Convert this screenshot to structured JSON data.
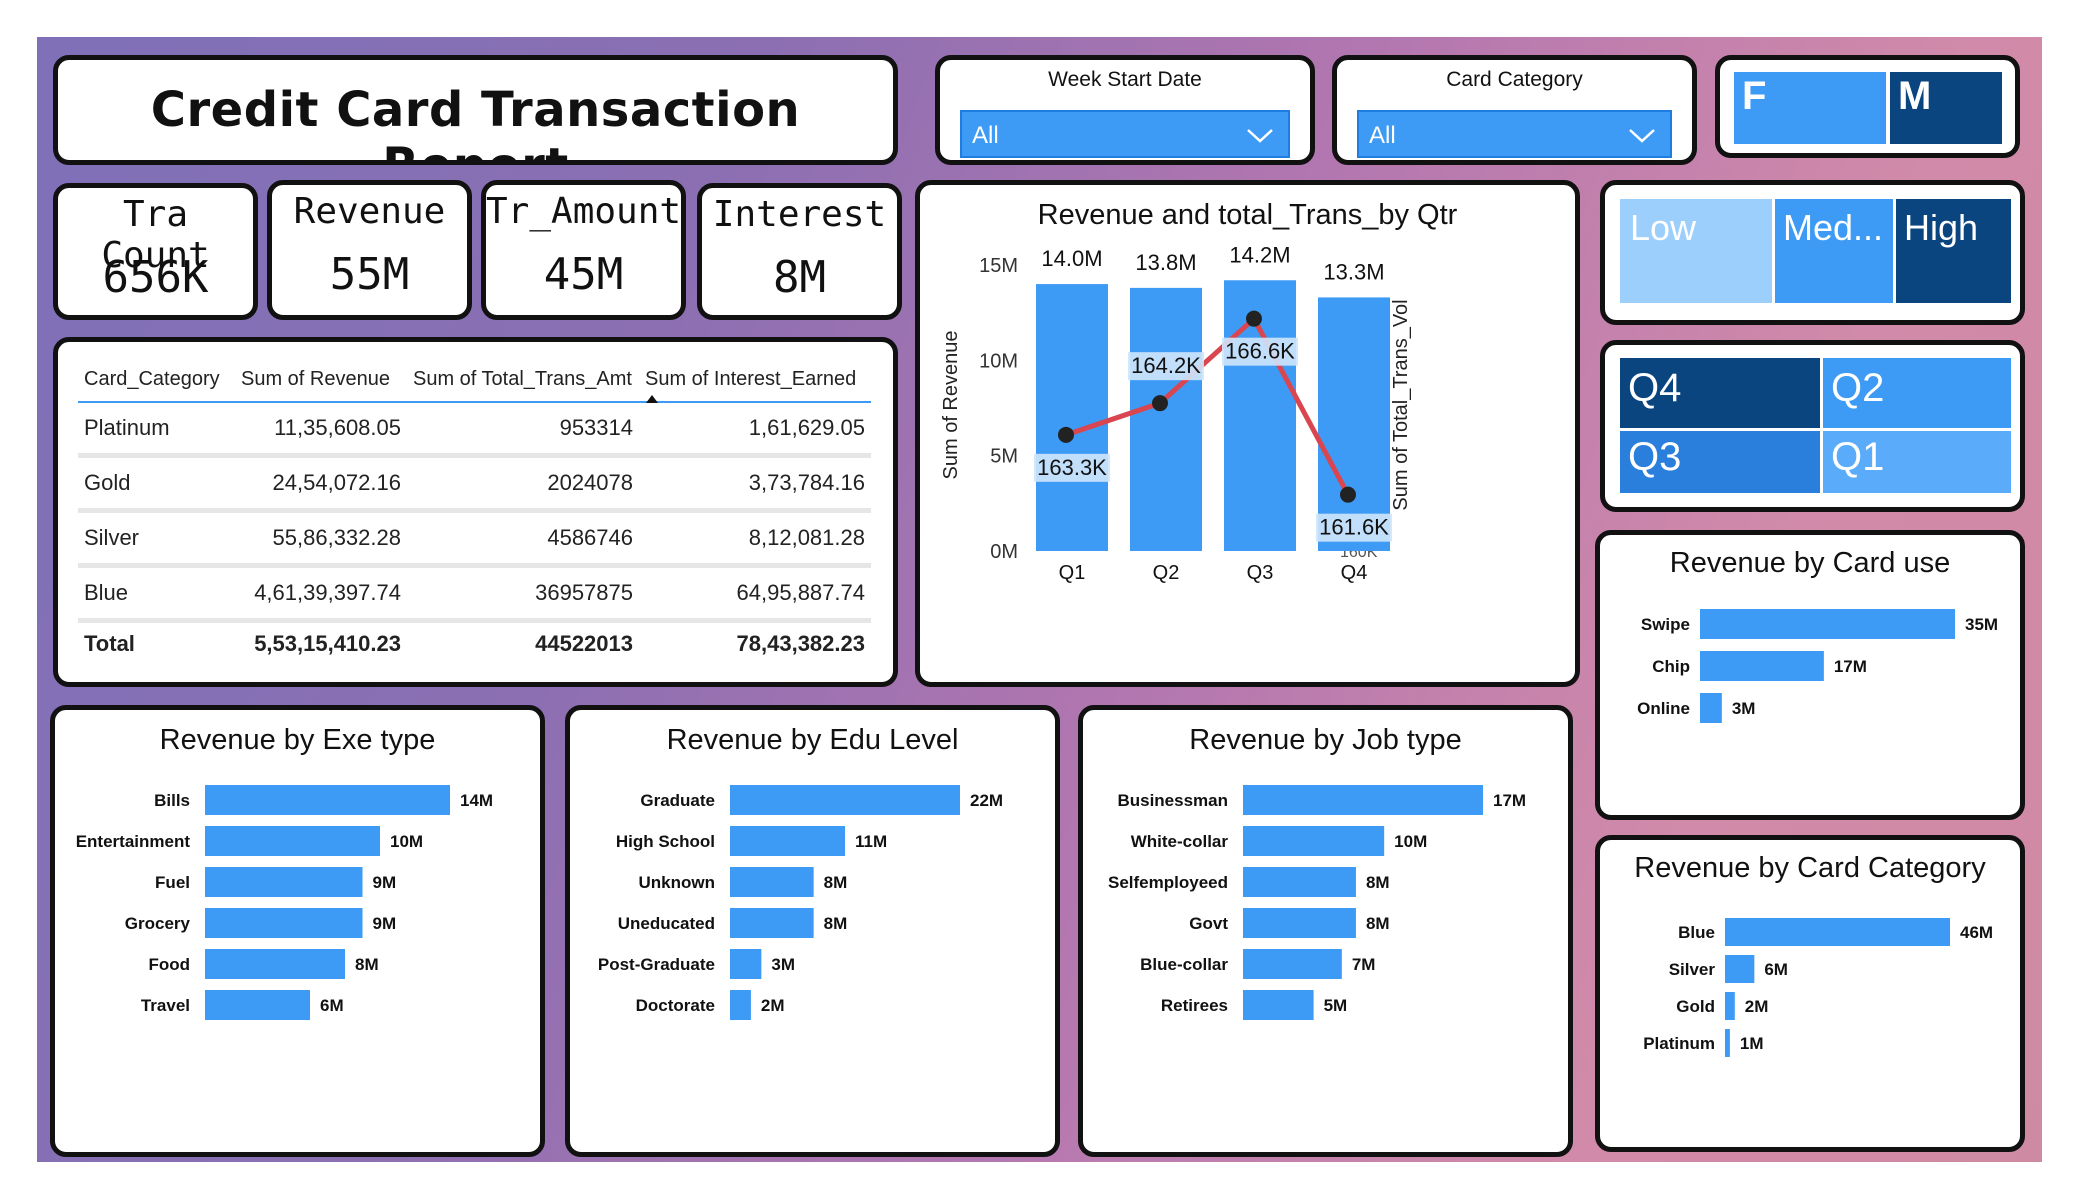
{
  "report_title": "Credit Card Transaction Report",
  "slicers": [
    {
      "label": "Week Start Date",
      "value": "All"
    },
    {
      "label": "Card Category",
      "value": "All"
    }
  ],
  "gender": {
    "f": "F",
    "m": "M"
  },
  "income_levels": [
    "Low",
    "Med...",
    "High"
  ],
  "quarter_tiles": [
    "Q4",
    "Q2",
    "Q3",
    "Q1"
  ],
  "kpis": [
    {
      "label": "Tra Count",
      "value": "656K"
    },
    {
      "label": "Revenue",
      "value": "55M"
    },
    {
      "label": "Tr_Amount",
      "value": "45M"
    },
    {
      "label": "Interest",
      "value": "8M"
    }
  ],
  "matrix": {
    "headers": [
      "Card_Category",
      "Sum of Revenue",
      "Sum of Total_Trans_Amt",
      "Sum of Interest_Earned"
    ],
    "rows": [
      [
        "Platinum",
        "11,35,608.05",
        "953314",
        "1,61,629.05"
      ],
      [
        "Gold",
        "24,54,072.16",
        "2024078",
        "3,73,784.16"
      ],
      [
        "Silver",
        "55,86,332.28",
        "4586746",
        "8,12,081.28"
      ],
      [
        "Blue",
        "4,61,39,397.74",
        "36957875",
        "64,95,887.74"
      ]
    ],
    "total": [
      "Total",
      "5,53,15,410.23",
      "44522013",
      "78,43,382.23"
    ]
  },
  "colors": {
    "bar": "#3d9af5",
    "dark": "#0b4580",
    "mid": "#2a7fdc",
    "light": "#9ccffb",
    "line": "#d9464f"
  },
  "chart_data": [
    {
      "type": "bar",
      "title": "Revenue and total_Trans_by Qtr",
      "categories": [
        "Q1",
        "Q2",
        "Q3",
        "Q4"
      ],
      "series": [
        {
          "values": [
            14.0,
            13.8,
            14.2,
            13.3
          ],
          "labels": [
            "14.0M",
            "13.8M",
            "14.2M",
            "13.3M"
          ]
        },
        {
          "values": [
            163.3,
            164.2,
            166.6,
            161.6
          ],
          "labels": [
            "163.3K",
            "164.2K",
            "166.6K",
            "161.6K"
          ]
        }
      ],
      "ylabel": "Sum of Revenue",
      "y2label": "Sum of Total_Trans_Vol",
      "ylim": [
        0,
        15
      ],
      "yticks": [
        "0M",
        "5M",
        "10M",
        "15M"
      ],
      "y2lim": [
        160,
        165
      ],
      "y2ticks": [
        "160K",
        "165K"
      ]
    },
    {
      "type": "bar",
      "title": "Revenue by Exe type",
      "categories": [
        "Bills",
        "Entertainment",
        "Fuel",
        "Grocery",
        "Food",
        "Travel"
      ],
      "values": [
        14,
        10,
        9,
        9,
        8,
        6
      ],
      "labels": [
        "14M",
        "10M",
        "9M",
        "9M",
        "8M",
        "6M"
      ]
    },
    {
      "type": "bar",
      "title": "Revenue by Edu Level",
      "categories": [
        "Graduate",
        "High School",
        "Unknown",
        "Uneducated",
        "Post-Graduate",
        "Doctorate"
      ],
      "values": [
        22,
        11,
        8,
        8,
        3,
        2
      ],
      "labels": [
        "22M",
        "11M",
        "8M",
        "8M",
        "3M",
        "2M"
      ]
    },
    {
      "type": "bar",
      "title": "Revenue by Job type",
      "categories": [
        "Businessman",
        "White-collar",
        "Selfemployeed",
        "Govt",
        "Blue-collar",
        "Retirees"
      ],
      "values": [
        17,
        10,
        8,
        8,
        7,
        5
      ],
      "labels": [
        "17M",
        "10M",
        "8M",
        "8M",
        "7M",
        "5M"
      ]
    },
    {
      "type": "bar",
      "title": "Revenue by Card use",
      "categories": [
        "Swipe",
        "Chip",
        "Online"
      ],
      "values": [
        35,
        17,
        3
      ],
      "labels": [
        "35M",
        "17M",
        "3M"
      ]
    },
    {
      "type": "bar",
      "title": "Revenue by Card Category",
      "categories": [
        "Blue",
        "Silver",
        "Gold",
        "Platinum"
      ],
      "values": [
        46,
        6,
        2,
        1
      ],
      "labels": [
        "46M",
        "6M",
        "2M",
        "1M"
      ]
    }
  ]
}
